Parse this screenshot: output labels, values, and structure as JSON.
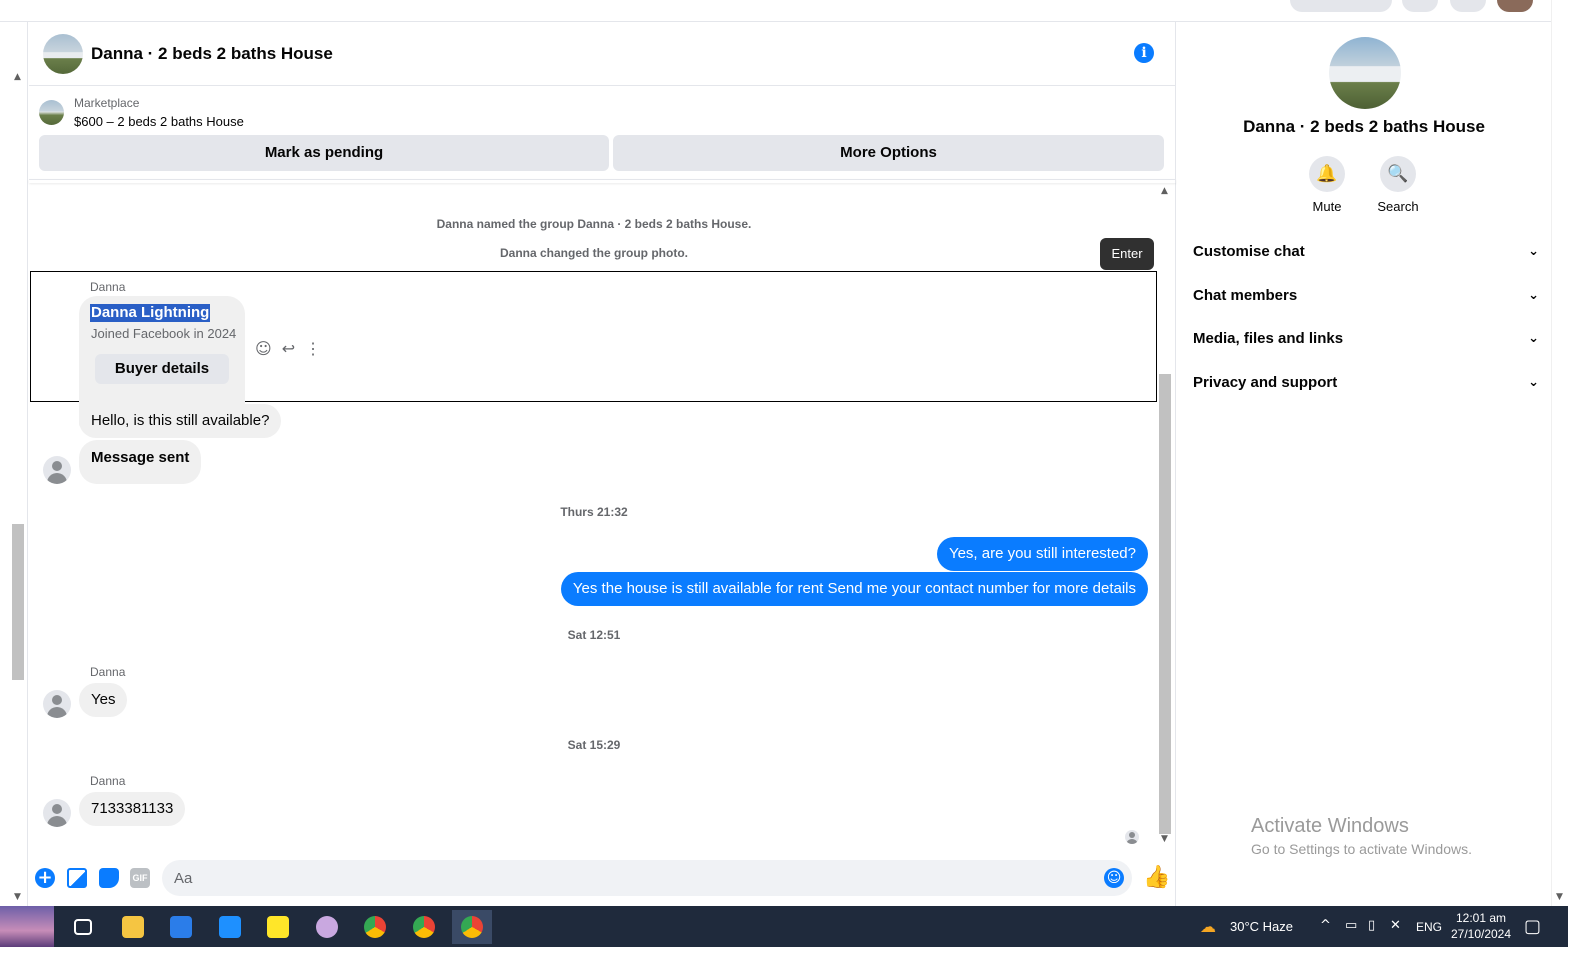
{
  "header": {
    "title": "Danna · 2 beds 2 baths House"
  },
  "marketplace": {
    "label": "Marketplace",
    "listing": "$600 – 2 beds 2 baths House"
  },
  "actions": {
    "pending": "Mark as pending",
    "more": "More Options"
  },
  "system_messages": [
    "Danna named the group Danna · 2 beds 2 baths House.",
    "Danna changed the group photo."
  ],
  "tooltip": "Enter",
  "card": {
    "sender": "Danna",
    "name": "Danna Lightning",
    "subtitle": "Joined Facebook in 2024",
    "button": "Buyer details"
  },
  "messages": {
    "m1": "Hello, is this still available?",
    "m2": "Message sent",
    "ts1": "Thurs 21:32",
    "m3": "Yes, are you still interested?",
    "m4": "Yes the house is still available for rent Send me your contact number for more details",
    "ts2": "Sat 12:51",
    "sender2": "Danna",
    "m5": "Yes",
    "ts3": "Sat 15:29",
    "sender3": "Danna",
    "m6": "7133381133"
  },
  "composer": {
    "placeholder": "Aa",
    "gif": "GIF"
  },
  "right_panel": {
    "title": "Danna · 2 beds 2 baths House",
    "mute": "Mute",
    "search": "Search",
    "sections": [
      "Customise chat",
      "Chat members",
      "Media, files and links",
      "Privacy and support"
    ]
  },
  "watermark": {
    "title": "Activate Windows",
    "subtitle": "Go to Settings to activate Windows."
  },
  "taskbar": {
    "weather": "30°C  Haze",
    "lang": "ENG",
    "time": "12:01 am",
    "date": "27/10/2024"
  },
  "colors": {
    "messenger_blue": "#0a7cff",
    "bubble_gray": "#f0f0f0",
    "taskbar": "#1f2a3c"
  }
}
